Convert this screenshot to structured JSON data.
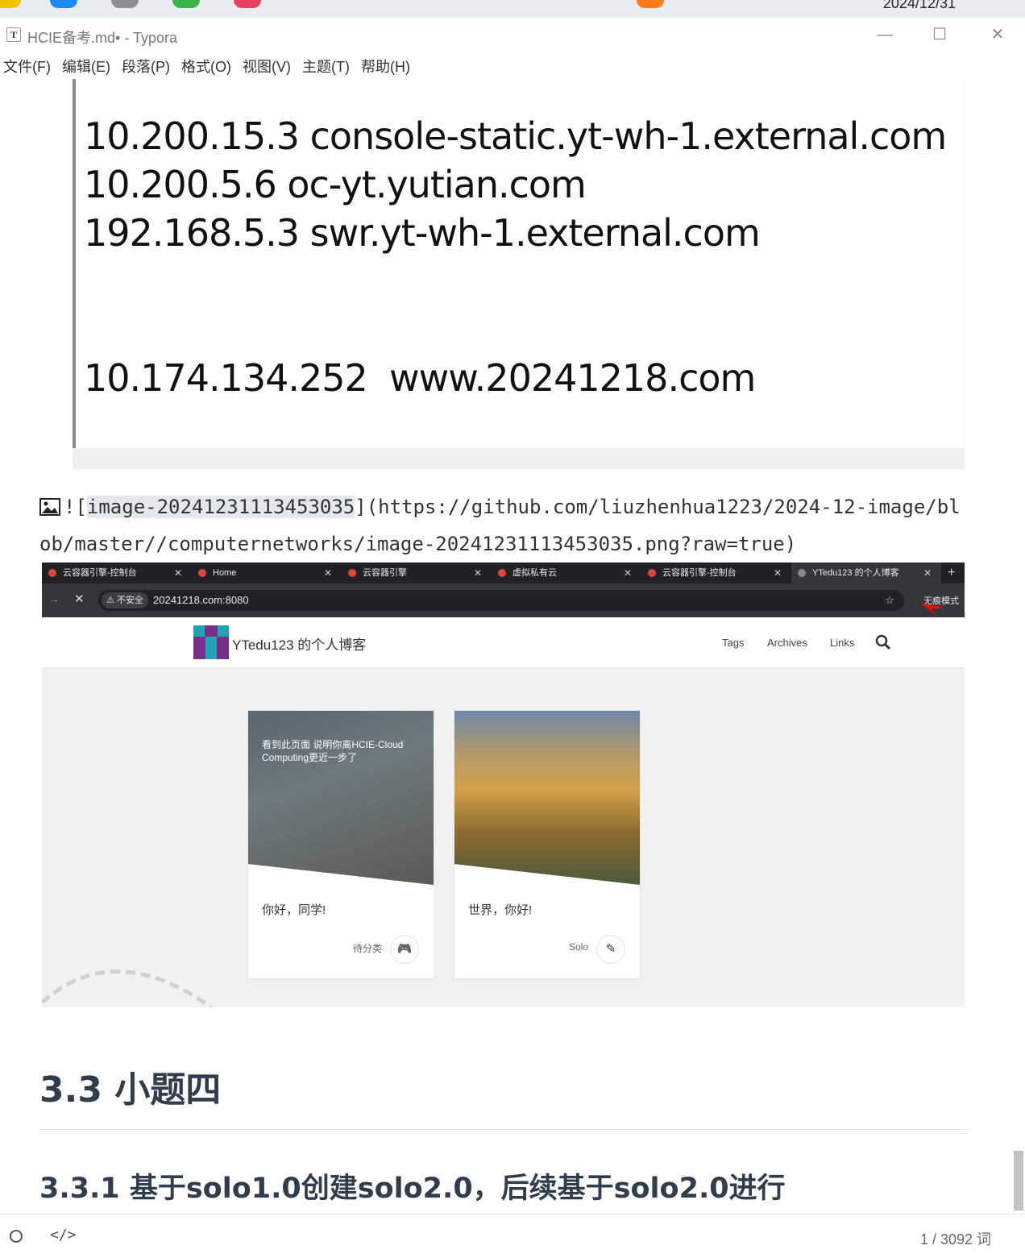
{
  "taskbar": {
    "date": "2024/12/31"
  },
  "window": {
    "app_icon_letter": "T",
    "title": "HCIE备考.md• - Typora"
  },
  "menu": [
    "文件(F)",
    "编辑(E)",
    "段落(P)",
    "格式(O)",
    "视图(V)",
    "主题(T)",
    "帮助(H)"
  ],
  "hosts_image": {
    "lines": [
      "10.200.15.3 console-static.yt-wh-1.external.com",
      "10.200.5.6 oc-yt.yutian.com",
      "192.168.5.3 swr.yt-wh-1.external.com",
      "10.174.134.252  www.20241218.com"
    ]
  },
  "markdown_source": {
    "prefix": "![",
    "alt": "image-20241231113453035",
    "suffix": "](https://github.com/liuzhenhua1223/2024-12-image/blob/master//computernetworks/image-20241231113453035.png?raw=true)"
  },
  "browser": {
    "tabs": [
      "云容器引擎-控制台",
      "Home",
      "云容器引擎",
      "虚拟私有云",
      "云容器引擎-控制台",
      "YTedu123 的个人博客"
    ],
    "insecure_label": "⚠ 不安全",
    "url": "20241218.com:8080",
    "profile_label": "无痕模式",
    "blog_title": "YTedu123 的个人博客",
    "nav": [
      "Tags",
      "Archives",
      "Links"
    ],
    "cards": [
      {
        "overlay": "看到此页面 说明你离HCIE-Cloud Computing更近一步了",
        "title": "你好，同学!",
        "meta": "待分类"
      },
      {
        "overlay": "",
        "title": "世界，你好!",
        "meta": "Solo"
      }
    ]
  },
  "headings": {
    "h3": "3.3 小题四",
    "h4": "3.3.1 基于solo1.0创建solo2.0，后续基于solo2.0进行"
  },
  "status": {
    "word_count": "1 / 3092 词",
    "code_toggle": "</>"
  },
  "colors": {
    "heading": "#2f3d4c",
    "selection": "#e3e8ef",
    "tab_bg": "#202124"
  }
}
